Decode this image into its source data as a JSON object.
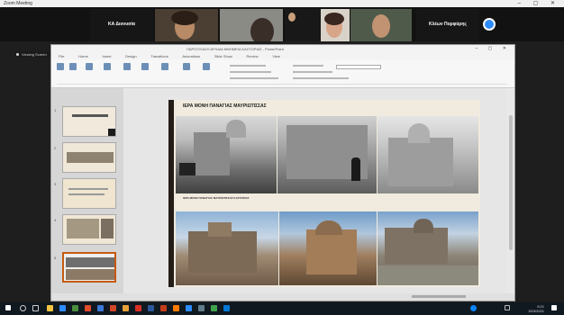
{
  "zoom": {
    "title": "Zoom Meeting",
    "window_controls": "– ▢ ✕"
  },
  "participants": [
    {
      "name": "ΚΑ Διονυσία"
    },
    {
      "name": ""
    },
    {
      "name": ""
    },
    {
      "name": ""
    },
    {
      "name": ""
    },
    {
      "name": "Κλέων Πορφύρης"
    }
  ],
  "share_indicator": "Viewing Screen",
  "ppt": {
    "doc_title": "ΠΑΡΟΥΣΙΑΣΗ ΑΡΧΑΙΑ ΜΝΗΜΕΙΑ ΚΑΣΤΟΡΙΑΣ - PowerPoint",
    "window_controls": "– ▢ ✕",
    "tabs": [
      "File",
      "Home",
      "Insert",
      "Design",
      "Transitions",
      "Animations",
      "Slide Show",
      "Review",
      "View"
    ],
    "slide_numbers": [
      "1",
      "2",
      "3",
      "4",
      "5"
    ]
  },
  "slide": {
    "title": "ΙΕΡΑ ΜΟΝΗ ΠΑΝΑΓΙΑΣ ΜΑΥΡΙΩΤΙΣΣΑΣ",
    "subtitle": "",
    "caption": "ΙΕΡΑ ΜΟΝΗ ΠΑΝΑΓΙΑΣ ΜΑΥΡΙΩΤΙΣΣΑΣ ΚΑΣΤΟΡΙΑΣ",
    "caption2": ""
  },
  "taskbar": {
    "time": "9:21",
    "date": "15/3/2021"
  }
}
